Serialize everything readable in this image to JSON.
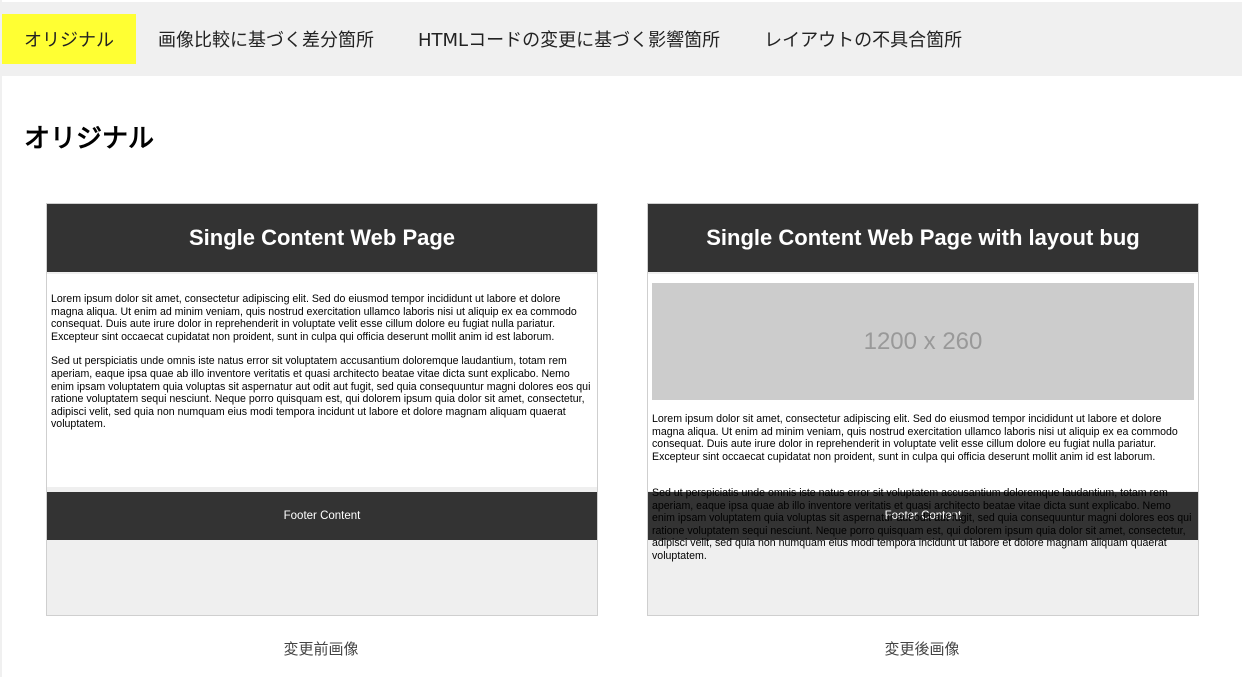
{
  "tabs": [
    {
      "label": "オリジナル"
    },
    {
      "label": "画像比較に基づく差分箇所"
    },
    {
      "label": "HTMLコードの変更に基づく影響箇所"
    },
    {
      "label": "レイアウトの不具合箇所"
    }
  ],
  "active_tab": "オリジナル",
  "page_title": "オリジナル",
  "before": {
    "header": "Single Content Web Page",
    "para1": "Lorem ipsum dolor sit amet, consectetur adipiscing elit. Sed do eiusmod tempor incididunt ut labore et dolore magna aliqua. Ut enim ad minim veniam, quis nostrud exercitation ullamco laboris nisi ut aliquip ex ea commodo consequat. Duis aute irure dolor in reprehenderit in voluptate velit esse cillum dolore eu fugiat nulla pariatur. Excepteur sint occaecat cupidatat non proident, sunt in culpa qui officia deserunt mollit anim id est laborum.",
    "para2": "Sed ut perspiciatis unde omnis iste natus error sit voluptatem accusantium doloremque laudantium, totam rem aperiam, eaque ipsa quae ab illo inventore veritatis et quasi architecto beatae vitae dicta sunt explicabo. Nemo enim ipsam voluptatem quia voluptas sit aspernatur aut odit aut fugit, sed quia consequuntur magni dolores eos qui ratione voluptatem sequi nesciunt. Neque porro quisquam est, qui dolorem ipsum quia dolor sit amet, consectetur, adipisci velit, sed quia non numquam eius modi tempora incidunt ut labore et dolore magnam aliquam quaerat voluptatem.",
    "footer": "Footer Content",
    "caption": "変更前画像"
  },
  "after": {
    "header": "Single Content Web Page with layout bug",
    "placeholder": "1200 x 260",
    "para1": "Lorem ipsum dolor sit amet, consectetur adipiscing elit. Sed do eiusmod tempor incididunt ut labore et dolore magna aliqua. Ut enim ad minim veniam, quis nostrud exercitation ullamco laboris nisi ut aliquip ex ea commodo consequat. Duis aute irure dolor in reprehenderit in voluptate velit esse cillum dolore eu fugiat nulla pariatur. Excepteur sint occaecat cupidatat non proident, sunt in culpa qui officia deserunt mollit anim id est laborum.",
    "para2": "Sed ut perspiciatis unde omnis iste natus error sit voluptatem accusantium doloremque laudantium, totam rem aperiam, eaque ipsa quae ab illo inventore veritatis et quasi architecto beatae vitae dicta sunt explicabo. Nemo enim ipsam voluptatem quia voluptas sit aspernatur aut odit aut fugit, sed quia consequuntur magni dolores eos qui ratione voluptatem sequi nesciunt. Neque porro quisquam est, qui dolorem ipsum quia dolor sit amet, consectetur, adipisci velit, sed quia non numquam eius modi tempora incidunt ut labore et dolore magnam aliquam quaerat voluptatem.",
    "footer": "Footer Content",
    "caption": "変更後画像"
  },
  "colors": {
    "active_tab_bg": "#ffff33",
    "tabbar_bg": "#f0f0f0",
    "mock_header_bg": "#333333",
    "placeholder_bg": "#cccccc"
  }
}
